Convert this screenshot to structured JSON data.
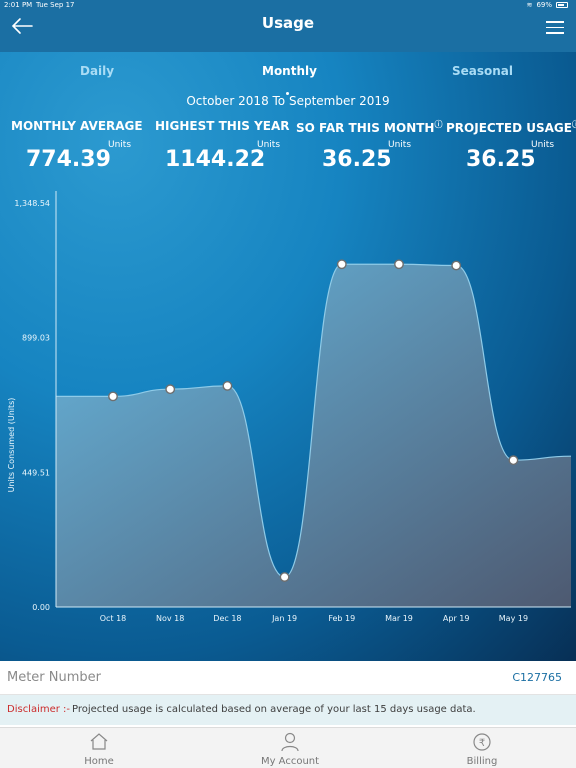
{
  "status_bar": {
    "time": "2:01 PM",
    "date": "Tue Sep 17",
    "battery": "69%"
  },
  "header": {
    "title": "Usage",
    "back_icon": "arrow-left-icon",
    "menu_icon": "hamburger-menu-icon"
  },
  "tabs": [
    {
      "label": "Daily",
      "active": false
    },
    {
      "label": "Monthly",
      "active": true
    },
    {
      "label": "Seasonal",
      "active": false
    }
  ],
  "period": "October 2018 To September 2019",
  "stats": [
    {
      "label": "MONTHLY AVERAGE",
      "unit": "Units",
      "value": "774.39"
    },
    {
      "label": "HIGHEST THIS YEAR",
      "unit": "Units",
      "value": "1144.22"
    },
    {
      "label": "SO FAR THIS MONTH",
      "unit": "Units",
      "value": "36.25",
      "info_icon": "info-icon"
    },
    {
      "label": "PROJECTED USAGE",
      "unit": "Units",
      "value": "36.25",
      "info_icon": "info-icon"
    }
  ],
  "chart_data": {
    "type": "area",
    "title": "",
    "xlabel": "",
    "ylabel": "Units Consumed (Units)",
    "categories": [
      "Oct 18",
      "Nov 18",
      "Dec 18",
      "Jan 19",
      "Feb 19",
      "Mar 19",
      "Apr 19",
      "May 19"
    ],
    "series": [
      {
        "values": [
          703,
          727,
          738,
          100,
          1144,
          1144,
          1140,
          490
        ]
      }
    ],
    "yticks": [
      "0.00",
      "449.51",
      "899.03",
      "1,348.54"
    ],
    "ylim": [
      0,
      1348.54
    ],
    "grid": false,
    "legend": "none",
    "colors": {
      "fill_top": "#6bb9df",
      "fill_bottom": "#4f5a71",
      "point": "#ffffff"
    }
  },
  "meter": {
    "label": "Meter Number",
    "value": "C127765"
  },
  "disclaimer": {
    "key": "Disclaimer :-",
    "text": "Projected usage is calculated based on average of your last 15 days usage data."
  },
  "nav": [
    {
      "label": "Home",
      "icon": "home-icon"
    },
    {
      "label": "My Account",
      "icon": "user-icon"
    },
    {
      "label": "Billing",
      "icon": "rupee-icon"
    }
  ]
}
